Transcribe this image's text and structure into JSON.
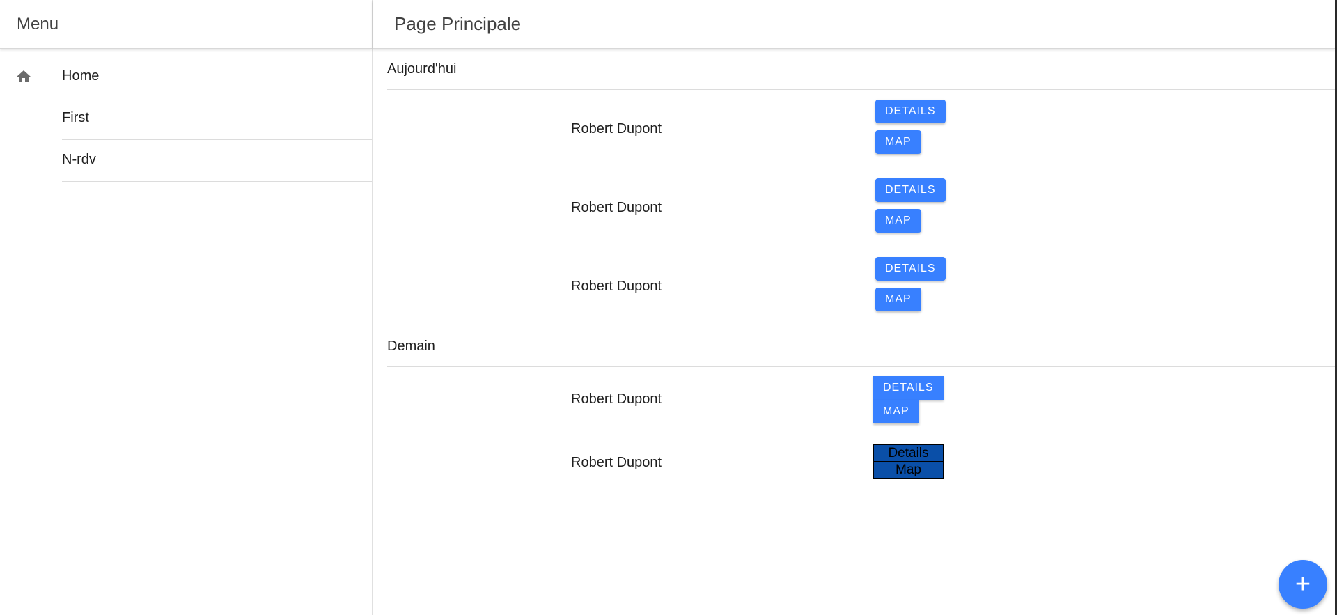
{
  "sidebar": {
    "title": "Menu",
    "items": [
      {
        "label": "Home",
        "icon": "home-icon"
      },
      {
        "label": "First"
      },
      {
        "label": "N-rdv"
      }
    ]
  },
  "main": {
    "title": "Page Principale",
    "sections": {
      "today": {
        "header": "Aujourd'hui",
        "rows": [
          {
            "name": "Robert Dupont",
            "details_label": "DETAILS",
            "map_label": "MAP"
          },
          {
            "name": "Robert Dupont",
            "details_label": "DETAILS",
            "map_label": "MAP"
          },
          {
            "name": "Robert Dupont",
            "details_label": "DETAILS",
            "map_label": "MAP"
          }
        ]
      },
      "tomorrow": {
        "header": "Demain",
        "rows": [
          {
            "name": "Robert Dupont",
            "details_label": "DETAILS",
            "map_label": "MAP"
          },
          {
            "name": "Robert Dupont",
            "details_label": "Details",
            "map_label": "Map"
          }
        ]
      }
    }
  },
  "fab": {
    "icon": "add-icon",
    "glyph": "+"
  },
  "colors": {
    "primary": "#3880ff",
    "dark_button": "#0a4fa8"
  }
}
